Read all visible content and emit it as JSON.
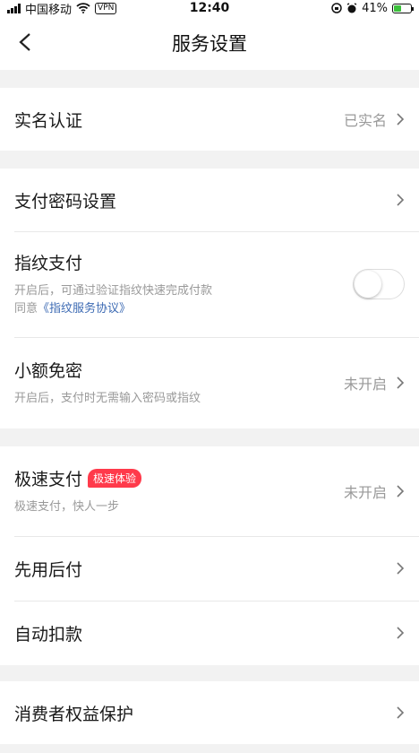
{
  "status_bar": {
    "carrier": "中国移动",
    "vpn": "VPN",
    "time": "12:40",
    "battery": "41%"
  },
  "nav": {
    "title": "服务设置"
  },
  "sections": {
    "real_name": {
      "title": "实名认证",
      "value": "已实名"
    },
    "pay_password": {
      "title": "支付密码设置"
    },
    "fingerprint": {
      "title": "指纹支付",
      "desc": "开启后，可通过验证指纹快速完成付款",
      "agree_prefix": "同意",
      "agree_link": "《指纹服务协议》",
      "enabled": false
    },
    "small_free": {
      "title": "小额免密",
      "desc": "开启后，支付时无需输入密码或指纹",
      "value": "未开启"
    },
    "fast_pay": {
      "title": "极速支付",
      "badge": "极速体验",
      "desc": "极速支付，快人一步",
      "value": "未开启"
    },
    "pay_later": {
      "title": "先用后付"
    },
    "auto_deduct": {
      "title": "自动扣款"
    },
    "consumer": {
      "title": "消费者权益保护"
    }
  }
}
